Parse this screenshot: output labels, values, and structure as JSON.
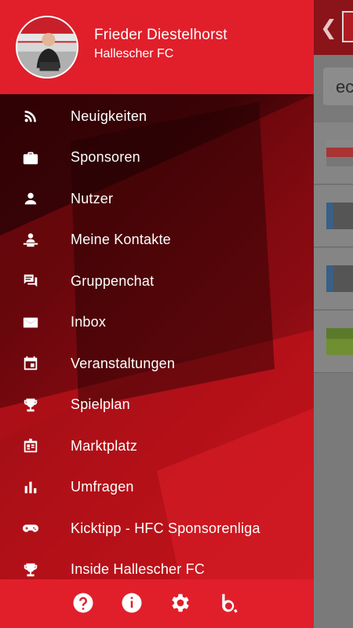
{
  "background_app": {
    "search_text": "ec"
  },
  "drawer": {
    "header": {
      "user_name": "Frieder Diestelhorst",
      "club_name": "Hallescher FC"
    },
    "menu": [
      {
        "label": "Neuigkeiten",
        "icon": "rss-icon"
      },
      {
        "label": "Sponsoren",
        "icon": "briefcase-icon"
      },
      {
        "label": "Nutzer",
        "icon": "person-icon"
      },
      {
        "label": "Meine Kontakte",
        "icon": "contact-desk-icon"
      },
      {
        "label": "Gruppenchat",
        "icon": "chat-icon"
      },
      {
        "label": "Inbox",
        "icon": "mail-icon"
      },
      {
        "label": "Veranstaltungen",
        "icon": "calendar-icon"
      },
      {
        "label": "Spielplan",
        "icon": "trophy-icon"
      },
      {
        "label": "Marktplatz",
        "icon": "storefront-icon"
      },
      {
        "label": "Umfragen",
        "icon": "bar-chart-icon"
      },
      {
        "label": "Kicktipp - HFC Sponsorenliga",
        "icon": "gamepad-icon"
      },
      {
        "label": "Inside Hallescher FC",
        "icon": "trophy-icon"
      }
    ],
    "footer": [
      "help-icon",
      "info-icon",
      "settings-icon",
      "brand-b-icon"
    ]
  },
  "colors": {
    "header_red": "#e01f2b",
    "drawer_dark": "#2a0204",
    "text": "#ffffff"
  }
}
